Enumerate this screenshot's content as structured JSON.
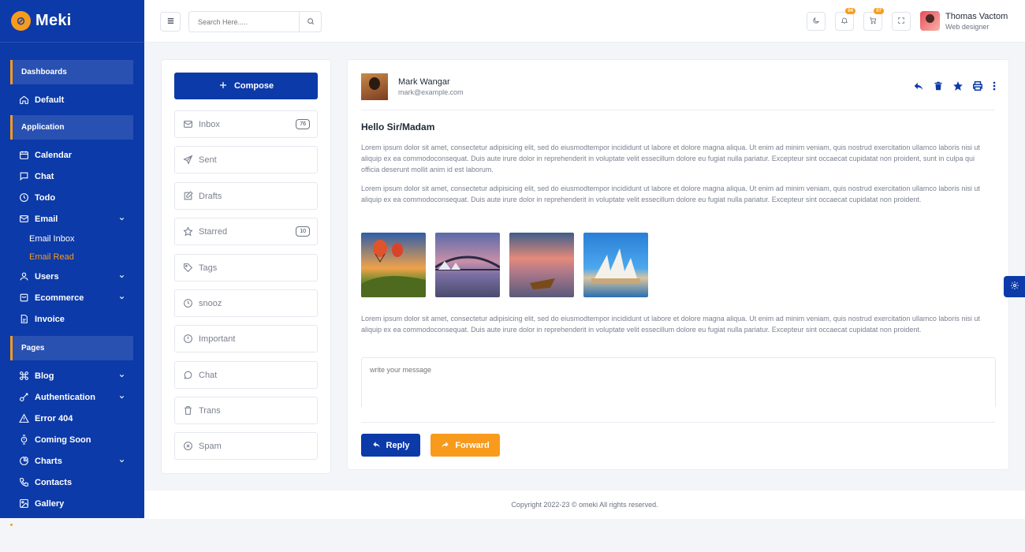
{
  "brand": {
    "name": "Meki"
  },
  "sidebar": {
    "sections": [
      {
        "title": "Dashboards",
        "items": [
          {
            "label": "Default",
            "icon": "home-icon"
          }
        ]
      },
      {
        "title": "Application",
        "items": [
          {
            "label": "Calendar",
            "icon": "calendar-icon"
          },
          {
            "label": "Chat",
            "icon": "chat-icon"
          },
          {
            "label": "Todo",
            "icon": "clock-icon"
          },
          {
            "label": "Email",
            "icon": "mail-icon",
            "expandable": true,
            "children": [
              {
                "label": "Email Inbox"
              },
              {
                "label": "Email Read",
                "active": true
              }
            ]
          },
          {
            "label": "Users",
            "icon": "user-icon",
            "expandable": true
          },
          {
            "label": "Ecommerce",
            "icon": "bag-icon",
            "expandable": true
          },
          {
            "label": "Invoice",
            "icon": "file-icon"
          }
        ]
      },
      {
        "title": "Pages",
        "items": [
          {
            "label": "Blog",
            "icon": "command-icon",
            "expandable": true
          },
          {
            "label": "Authentication",
            "icon": "key-icon",
            "expandable": true
          },
          {
            "label": "Error 404",
            "icon": "warning-icon"
          },
          {
            "label": "Coming Soon",
            "icon": "watch-icon"
          },
          {
            "label": "Charts",
            "icon": "pie-icon",
            "expandable": true
          },
          {
            "label": "Contacts",
            "icon": "phone-icon"
          },
          {
            "label": "Gallery",
            "icon": "image-icon"
          }
        ]
      }
    ]
  },
  "topbar": {
    "search_placeholder": "Search Here.....",
    "notifications_count": "04",
    "cart_count": "07",
    "user_name": "Thomas Vactom",
    "user_role": "Web designer"
  },
  "folders": {
    "compose_label": "Compose",
    "items": [
      {
        "label": "Inbox",
        "icon": "mail-icon",
        "count": "76"
      },
      {
        "label": "Sent",
        "icon": "send-icon"
      },
      {
        "label": "Drafts",
        "icon": "edit-icon"
      },
      {
        "label": "Starred",
        "icon": "star-icon",
        "count": "10"
      },
      {
        "label": "Tags",
        "icon": "tag-icon"
      },
      {
        "label": "snooz",
        "icon": "clock-icon"
      },
      {
        "label": "Important",
        "icon": "alert-icon"
      },
      {
        "label": "Chat",
        "icon": "chat-icon"
      },
      {
        "label": "Trans",
        "icon": "trash-icon"
      },
      {
        "label": "Spam",
        "icon": "x-circle-icon"
      }
    ]
  },
  "mail": {
    "sender_name": "Mark Wangar",
    "sender_email": "mark@example.com",
    "subject": "Hello Sir/Madam",
    "paragraphs": [
      "Lorem ipsum dolor sit amet, consectetur adipisicing elit, sed do eiusmodtempor incididunt ut labore et dolore magna aliqua. Ut enim ad minim veniam, quis nostrud exercitation ullamco laboris nisi ut aliquip ex ea commodoconsequat. Duis aute irure dolor in reprehenderit in voluptate velit essecillum dolore eu fugiat nulla pariatur. Excepteur sint occaecat cupidatat non proident, sunt in culpa qui officia deserunt mollit anim id est laborum.",
      "Lorem ipsum dolor sit amet, consectetur adipisicing elit, sed do eiusmodtempor incididunt ut labore et dolore magna aliqua. Ut enim ad minim veniam, quis nostrud exercitation ullamco laboris nisi ut aliquip ex ea commodoconsequat. Duis aute irure dolor in reprehenderit in voluptate velit essecillum dolore eu fugiat nulla pariatur. Excepteur sint occaecat cupidatat non proident.",
      "Lorem ipsum dolor sit amet, consectetur adipisicing elit, sed do eiusmodtempor incididunt ut labore et dolore magna aliqua. Ut enim ad minim veniam, quis nostrud exercitation ullamco laboris nisi ut aliquip ex ea commodoconsequat. Duis aute irure dolor in reprehenderit in voluptate velit essecillum dolore eu fugiat nulla pariatur. Excepteur sint occaecat cupidatat non proident."
    ],
    "message_placeholder": "write your message",
    "reply_label": "Reply",
    "forward_label": "Forward"
  },
  "footer": {
    "copyright": "Copyright 2022-23 © omeki All rights reserved."
  },
  "colors": {
    "primary": "#0c3aa8",
    "accent": "#f89b1c"
  }
}
